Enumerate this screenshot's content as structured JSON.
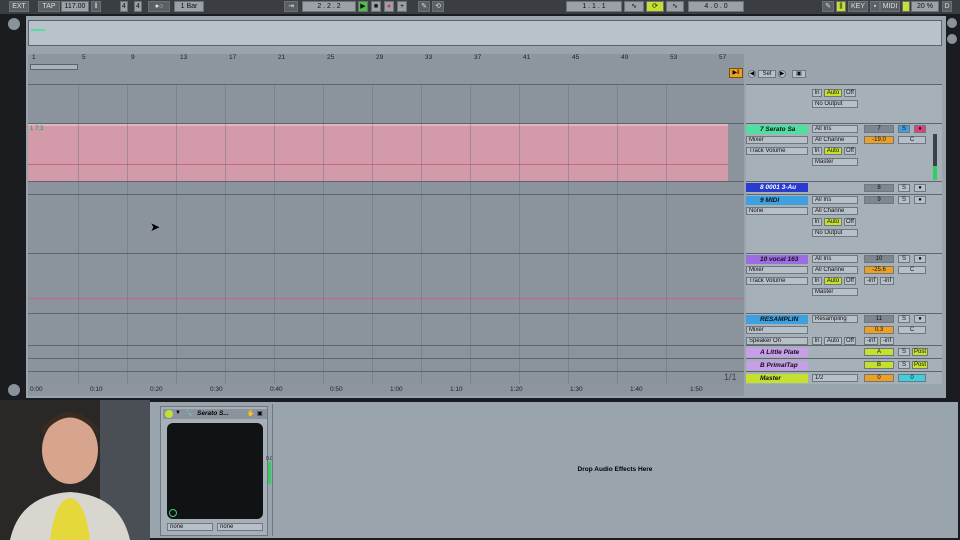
{
  "transport": {
    "ext": "EXT",
    "tap": "TAP",
    "tempo": "117.00",
    "sig_num": "4",
    "sig_den": "4",
    "quant": "1 Bar",
    "position": "2 . 2 . 2",
    "loop_start": "1 . 1 . 1",
    "loop_len": "4 . 0 . 0",
    "key": "KEY",
    "midi": "MIDI",
    "cpu": "20 %",
    "d": "D"
  },
  "ruler": [
    "1",
    "5",
    "9",
    "13",
    "17",
    "21",
    "25",
    "29",
    "33",
    "37",
    "41",
    "45",
    "49",
    "53",
    "57"
  ],
  "set_label": "Set",
  "clip": {
    "label": "1 7:3"
  },
  "tracks": [
    {
      "name": "7 Serato Sa",
      "color": "#4fe0a0",
      "in": "All Ins",
      "ch": "All Channe",
      "mon_in": "In",
      "mon_auto": "Auto",
      "mon_off": "Off",
      "mixer": "Mixer",
      "tv": "Track Volume",
      "out": "Master",
      "num": "7",
      "vol": "-19.0",
      "pan": "C"
    },
    {
      "name": "8 0001 3-Au",
      "color": "#2a3bd0",
      "num": "8"
    },
    {
      "name": "9 MIDI",
      "color": "#3fa0e0",
      "in": "All Ins",
      "ch": "All Channe",
      "none": "None",
      "mon_in": "In",
      "mon_auto": "Auto",
      "mon_off": "Off",
      "out": "No Output",
      "num": "9"
    },
    {
      "name": "10 vocal 163",
      "color": "#9b6de0",
      "in": "All Ins",
      "ch": "All Channe",
      "mixer": "Mixer",
      "tv": "Track Volume",
      "mon_in": "In",
      "mon_auto": "Auto",
      "mon_off": "Off",
      "out": "Master",
      "num": "10",
      "vol": "-25.6",
      "pan": "C",
      "inf1": "-inf",
      "inf2": "-inf"
    },
    {
      "name": "RESAMPLIN",
      "color": "#3fa0e0",
      "in": "Resampling",
      "mixer": "Mixer",
      "speaker": "Speaker On",
      "mon_in": "In",
      "mon_auto": "Auto",
      "mon_off": "Off",
      "num": "11",
      "vol": "0.3",
      "pan": "C"
    }
  ],
  "top_track": {
    "mon_in": "In",
    "mon_auto": "Auto",
    "mon_off": "Off",
    "out": "No Output"
  },
  "returns": [
    {
      "name": "A Little Plate",
      "letter": "A",
      "post": "Post"
    },
    {
      "name": "B PrimalTap",
      "letter": "B",
      "post": "Post"
    }
  ],
  "master": {
    "name": "Master",
    "out": "1/2",
    "vol": "0",
    "pan": "0"
  },
  "clip_count": "1/1",
  "timeline": [
    "0:00",
    "0:10",
    "0:20",
    "0:30",
    "0:40",
    "0:50",
    "1:00",
    "1:10",
    "1:20",
    "1:30",
    "1:40",
    "1:50"
  ],
  "device": {
    "name": "Serato S...",
    "sel1": "none",
    "sel2": "none",
    "meter": "0.0"
  },
  "drop_text": "Drop Audio Effects Here",
  "inf_a": "-inf",
  "inf_b": "-inf"
}
